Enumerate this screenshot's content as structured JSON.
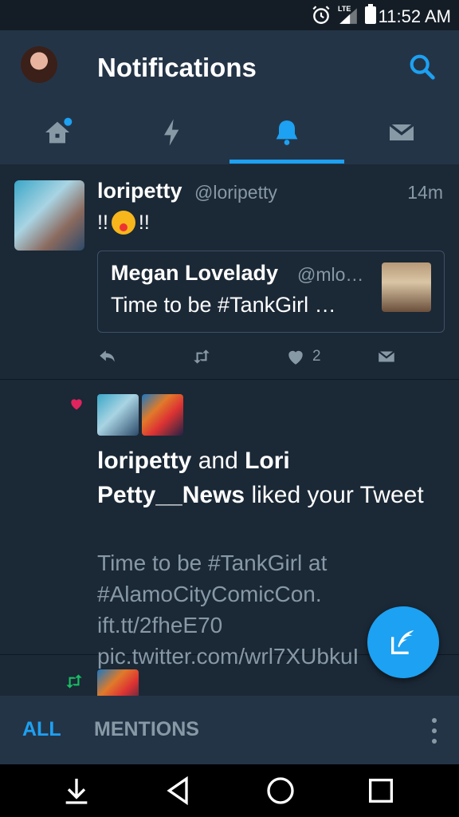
{
  "status_bar": {
    "time": "11:52 AM",
    "network": "LTE"
  },
  "header": {
    "title": "Notifications",
    "icons": [
      "avatar",
      "search-icon"
    ]
  },
  "tabs": [
    {
      "name": "home",
      "icon": "home-icon",
      "has_dot": true,
      "active": false
    },
    {
      "name": "moments",
      "icon": "lightning-icon",
      "active": false
    },
    {
      "name": "notifications",
      "icon": "bell-icon",
      "active": true
    },
    {
      "name": "messages",
      "icon": "envelope-icon",
      "active": false
    }
  ],
  "feed": {
    "tweet": {
      "name": "loripetty",
      "handle": "@loripetty",
      "time": "14m",
      "text_before": "!!",
      "emoji": "winking-tongue-face",
      "text_after": "!!",
      "quote": {
        "name": "Megan Lovelady",
        "handle": "@mlo…",
        "text": "Time to be #TankGirl …"
      },
      "actions": {
        "reply": "reply-icon",
        "retweet": "retweet-icon",
        "like_count": "2",
        "dm": "envelope-icon"
      }
    },
    "like_notification": {
      "user1": "loripetty",
      "and": " and ",
      "user2": "Lori Petty__News",
      "action": " liked your Tweet",
      "tweet_text": "Time to be #TankGirl at #AlamoCityComicCon. ift.tt/2fheE70 pic.twitter.com/wrl7XUbkuI"
    },
    "retweet_notification": {
      "icon": "retweet-icon"
    }
  },
  "bottom_bar": {
    "filter_all": "ALL",
    "filter_mentions": "MENTIONS"
  },
  "colors": {
    "accent": "#1da1f2",
    "background": "#1b2836",
    "header_bg": "#243447",
    "secondary_text": "#8899a6",
    "like": "#e0245e",
    "retweet": "#17bf63"
  }
}
